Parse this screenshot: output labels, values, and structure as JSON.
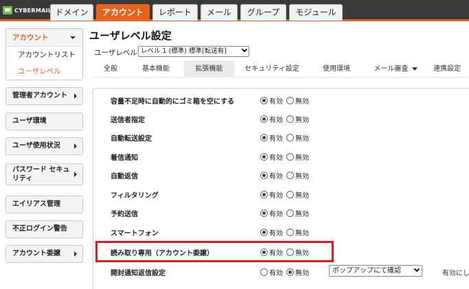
{
  "app": {
    "logo_text": "CYBERMAIL"
  },
  "top_tabs": [
    {
      "label": "ドメイン",
      "active": false
    },
    {
      "label": "アカウント",
      "active": true
    },
    {
      "label": "レポート",
      "active": false
    },
    {
      "label": "メール",
      "active": false
    },
    {
      "label": "グループ",
      "active": false
    },
    {
      "label": "モジュール",
      "active": false
    }
  ],
  "sidebar": {
    "account_group": {
      "label": "アカウント",
      "items": [
        {
          "label": "アカウントリスト",
          "active": false
        },
        {
          "label": "ユーザレベル",
          "active": true
        }
      ]
    },
    "items": [
      {
        "label": "管理者アカウント",
        "has_arrow": true
      },
      {
        "label": "ユーザ環境",
        "has_arrow": false
      },
      {
        "label": "ユーザ使用状況",
        "has_arrow": true
      },
      {
        "label": "パスワード セキュリティ",
        "has_arrow": true
      },
      {
        "label": "エイリアス管理",
        "has_arrow": false
      },
      {
        "label": "不正ログイン警告",
        "has_arrow": false
      },
      {
        "label": "アカウント委譲",
        "has_arrow": true
      }
    ]
  },
  "main": {
    "title": "ユーザレベル設定",
    "level_label": "ユーザレベル",
    "level_selected": "レベル 1 (標準) 標準[転送有]",
    "subtabs": [
      {
        "label": "全般",
        "active": false
      },
      {
        "label": "基本機能",
        "active": false
      },
      {
        "label": "拡張機能",
        "active": true
      },
      {
        "label": "セキュリティ設定",
        "active": false
      },
      {
        "label": "使用環境",
        "active": false
      },
      {
        "label": "メール審査",
        "active": false,
        "dropdown": true
      },
      {
        "label": "連携設定",
        "active": false
      }
    ],
    "radio_on_label": "有効",
    "radio_off_label": "無効",
    "settings": [
      {
        "label": "容量不足時に自動的にゴミ箱を空にする",
        "enabled": true
      },
      {
        "label": "送信者指定",
        "enabled": true
      },
      {
        "label": "自動転送設定",
        "enabled": true
      },
      {
        "label": "着信通知",
        "enabled": true
      },
      {
        "label": "自動返信",
        "enabled": true
      },
      {
        "label": "フィルタリング",
        "enabled": true
      },
      {
        "label": "予約送信",
        "enabled": true
      },
      {
        "label": "スマートフォン",
        "enabled": true
      },
      {
        "label": "読み取り専用（アカウント委譲）",
        "enabled": true,
        "highlighted": true
      },
      {
        "label": "開封通知返信設定",
        "enabled": false,
        "popup_select": "ポップアップにて確認",
        "right_note": "有効にし"
      }
    ]
  },
  "colors": {
    "accent": "#e8621c",
    "highlight": "#e21a1a",
    "topbar": "#3a3a3a"
  }
}
